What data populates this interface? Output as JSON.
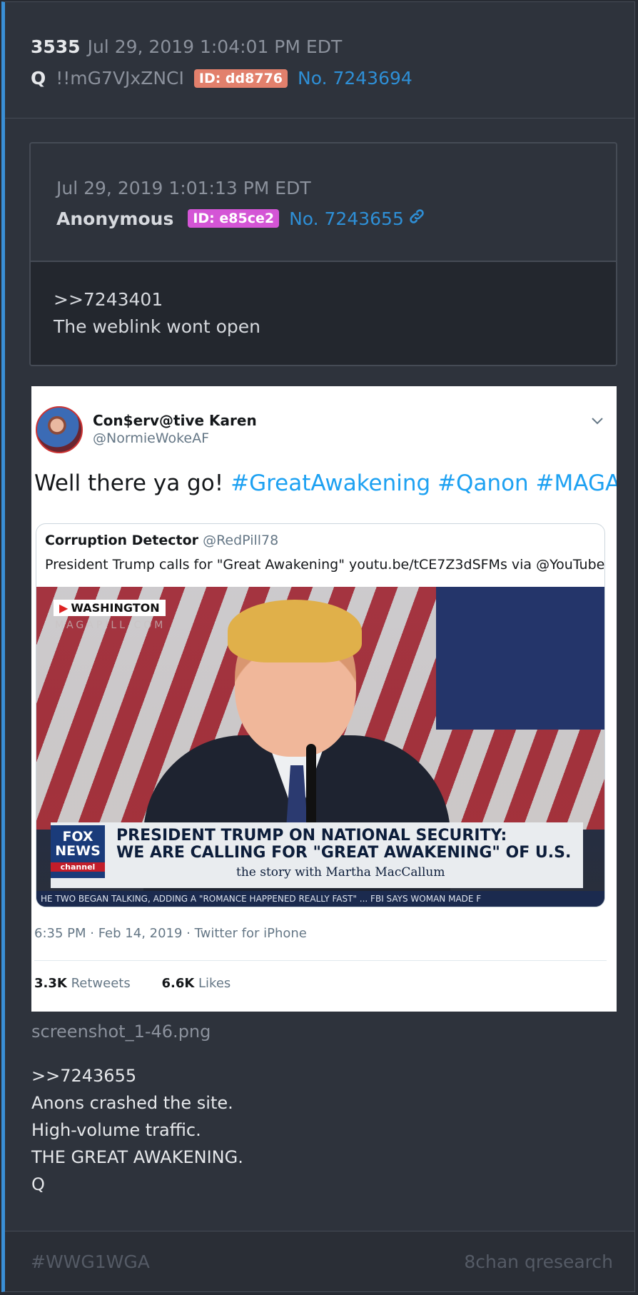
{
  "post": {
    "number": "3535",
    "timestamp": "Jul 29, 2019 1:04:01 PM EDT",
    "author": "Q",
    "tripcode": "!!mG7VJxZNCI",
    "id_badge": "ID: dd8776",
    "post_no": "No. 7243694"
  },
  "quoted": {
    "timestamp": "Jul 29, 2019 1:01:13 PM EDT",
    "author": "Anonymous",
    "id_badge": "ID: e85ce2",
    "post_no": "No. 7243655",
    "link_icon": "link-icon",
    "lines": [
      ">>7243401",
      "The weblink wont open"
    ]
  },
  "tweet": {
    "name": "Con$erv@tive Karen",
    "handle": "@NormieWokeAF",
    "text": "Well there ya go!",
    "hashtags": "#GreatAwakening #Qanon #MAGA",
    "quoted_tweet": {
      "name": "Corruption Detector",
      "handle": "@RedPill78",
      "text": "President Trump calls for \"Great Awakening\" youtu.be/tCE7Z3dSFMs via @YouTube",
      "video": {
        "location_tag": "WASHINGTON",
        "watermark": "MAGAPILL.COM",
        "network_logo_1": "FOX",
        "network_logo_2": "NEWS",
        "network_logo_3": "channel",
        "headline_1": "PRESIDENT TRUMP ON NATIONAL SECURITY:",
        "headline_2": "WE ARE CALLING FOR \"GREAT AWAKENING\" OF U.S.",
        "show": "the story with Martha MacCallum",
        "ticker": "HE TWO BEGAN TALKING, ADDING A \"ROMANCE HAPPENED REALLY FAST\" ... FBI SAYS WOMAN MADE F"
      }
    },
    "meta": "6:35 PM · Feb 14, 2019 · Twitter for iPhone",
    "retweets_count": "3.3K",
    "retweets_label": "Retweets",
    "likes_count": "6.6K",
    "likes_label": "Likes"
  },
  "attachment_filename": "screenshot_1-46.png",
  "body_lines": [
    ">>7243655",
    "Anons crashed the site.",
    "High-volume traffic.",
    "THE GREAT AWAKENING.",
    "Q"
  ],
  "footer": {
    "tag": "#WWG1WGA",
    "source": "8chan qresearch"
  },
  "colors": {
    "background": "#272b33",
    "card": "#2e333c",
    "accent_border": "#3a8fd6",
    "link": "#2e8fd6",
    "q_id_badge": "#e2806c",
    "anon_id_badge": "#d455d6",
    "twitter_blue": "#1da1f2"
  }
}
